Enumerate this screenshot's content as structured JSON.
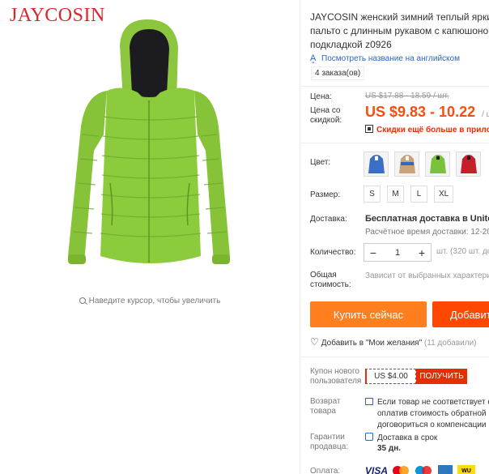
{
  "brand": "JAYCOSIN",
  "zoom_hint": "Наведите курсор, чтобы увеличить",
  "product": {
    "title_lines": [
      "JAYCOSIN женский зимний теплый ярки",
      "пальто с длинным рукавом с капюшоно",
      "подкладкой z0926"
    ],
    "translate_link": "Посмотреть название на английском",
    "orders": "4 заказа(ов)"
  },
  "price": {
    "old_label": "Цена:",
    "old_value": "US $17.88 - 18.59 / шт.",
    "new_label_lines": [
      "Цена со",
      "скидкой:"
    ],
    "new_value": "US $9.83 - 10.22",
    "new_unit": "/ шт",
    "promo": "Скидки ещё больше в приложе"
  },
  "options": {
    "color_label": "Цвет:",
    "colors": [
      {
        "name": "blue",
        "hex": "#3a6fc4"
      },
      {
        "name": "multicolor",
        "hex": "#c9a27a"
      },
      {
        "name": "green",
        "hex": "#7ac23a"
      },
      {
        "name": "red",
        "hex": "#c4202a"
      }
    ],
    "size_label": "Размер:",
    "sizes": [
      "S",
      "M",
      "L",
      "XL"
    ]
  },
  "shipping": {
    "label": "Доставка:",
    "free": "Бесплатная доставка в United S",
    "time": "Расчётное время доставки: 12-20"
  },
  "quantity": {
    "label": "Количество:",
    "minus": "−",
    "value": "1",
    "plus": "+",
    "available": "шт. (320 шт. до"
  },
  "total": {
    "label_lines": [
      "Общая",
      "стоимость:"
    ],
    "value": "Зависит от выбранных характери"
  },
  "actions": {
    "buy_now": "Купить сейчас",
    "add_to_cart": "Добавит"
  },
  "wishlist": {
    "label": "Добавить в \"Мои желания\"",
    "count": "(11 добавили)"
  },
  "coupon": {
    "label_lines": [
      "Купон нового",
      "пользователя"
    ],
    "amount": "US $4.00",
    "button": "ПОЛУЧИТЬ"
  },
  "returns": {
    "label_lines": [
      "Возврат",
      "товара"
    ],
    "text_lines": [
      "Если товар не соответствует о",
      "оплатив стоимость обратной",
      "договориться о компенсации"
    ]
  },
  "guarantee": {
    "label_lines": [
      "Гарантии",
      "продавца:"
    ],
    "line1": "Доставка в срок",
    "line2": "35 дн."
  },
  "payment": {
    "label": "Оплата:",
    "visa": "VISA",
    "wu": "WU"
  },
  "colors": {
    "accent": "#f44f0f",
    "buy": "#ff7e1e",
    "cart": "#ff4701",
    "link": "#2a66c2",
    "brand": "#d9262c",
    "jacket": "#8ccc3c"
  }
}
